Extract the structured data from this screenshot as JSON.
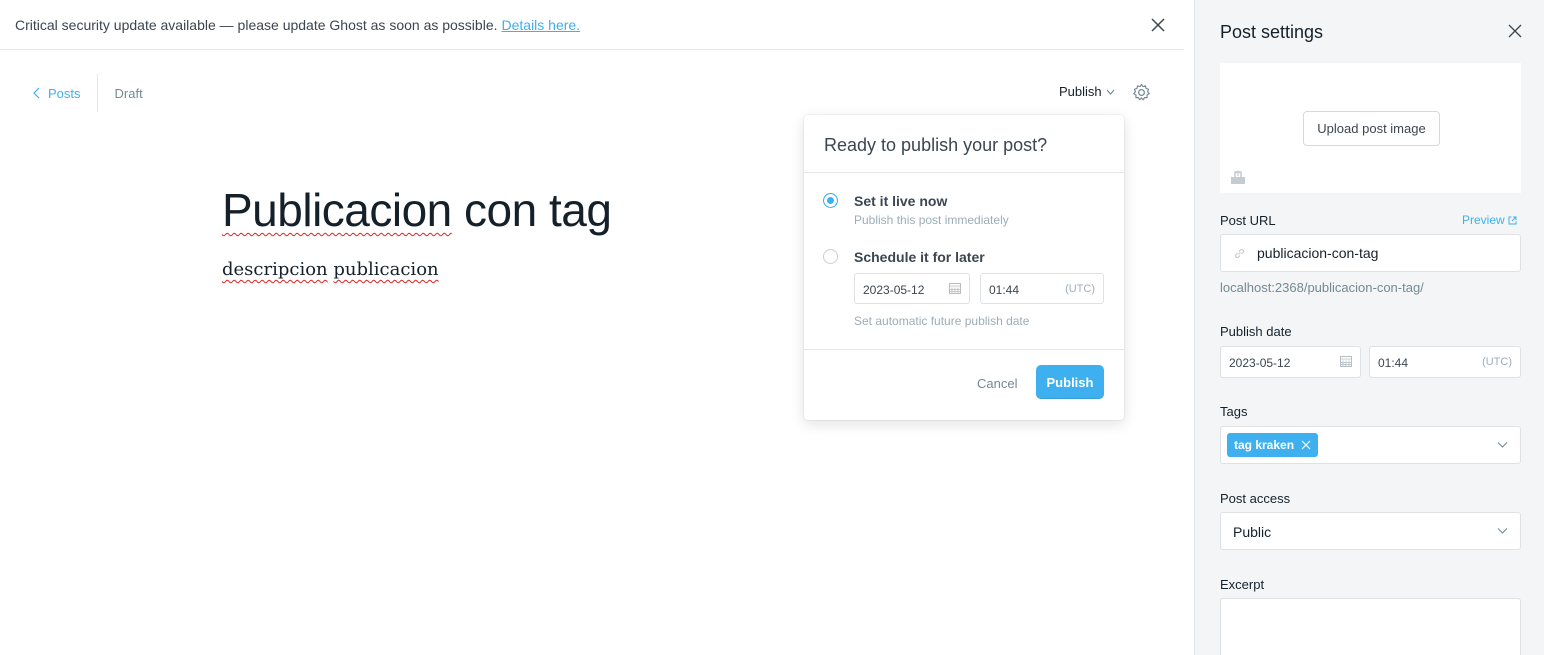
{
  "banner": {
    "message": "Critical security update available — please update Ghost as soon as possible.",
    "link_text": "Details here."
  },
  "editor": {
    "breadcrumb_posts": "Posts",
    "status": "Draft",
    "publish_menu_label": "Publish",
    "title_word1": "Publicacion",
    "title_rest": " con tag",
    "body_word1": "descripcion",
    "body_word2": "publicacion"
  },
  "publish_popover": {
    "heading": "Ready to publish your post?",
    "option_now_title": "Set it live now",
    "option_now_desc": "Publish this post immediately",
    "option_schedule_title": "Schedule it for later",
    "date": "2023-05-12",
    "time": "01:44",
    "tz": "(UTC)",
    "hint": "Set automatic future publish date",
    "cancel_label": "Cancel",
    "publish_label": "Publish",
    "selected_option": "now"
  },
  "settings": {
    "title": "Post settings",
    "upload_label": "Upload post image",
    "post_url_label": "Post URL",
    "preview_label": "Preview",
    "slug": "publicacion-con-tag",
    "full_url": "localhost:2368/publicacion-con-tag/",
    "publish_date_label": "Publish date",
    "date": "2023-05-12",
    "time": "01:44",
    "tz": "(UTC)",
    "tags_label": "Tags",
    "tags": [
      "tag kraken"
    ],
    "access_label": "Post access",
    "access_value": "Public",
    "excerpt_label": "Excerpt",
    "excerpt_value": ""
  },
  "colors": {
    "accent": "#3eb0ef",
    "panel_bg": "#f4f5f6",
    "text": "#15212a",
    "muted": "#738a94"
  },
  "icons": [
    "close-icon",
    "chevron-left-icon",
    "chevron-down-icon",
    "gear-icon",
    "calendar-icon",
    "image-icon",
    "link-icon",
    "external-link-icon",
    "tag-remove-icon"
  ]
}
